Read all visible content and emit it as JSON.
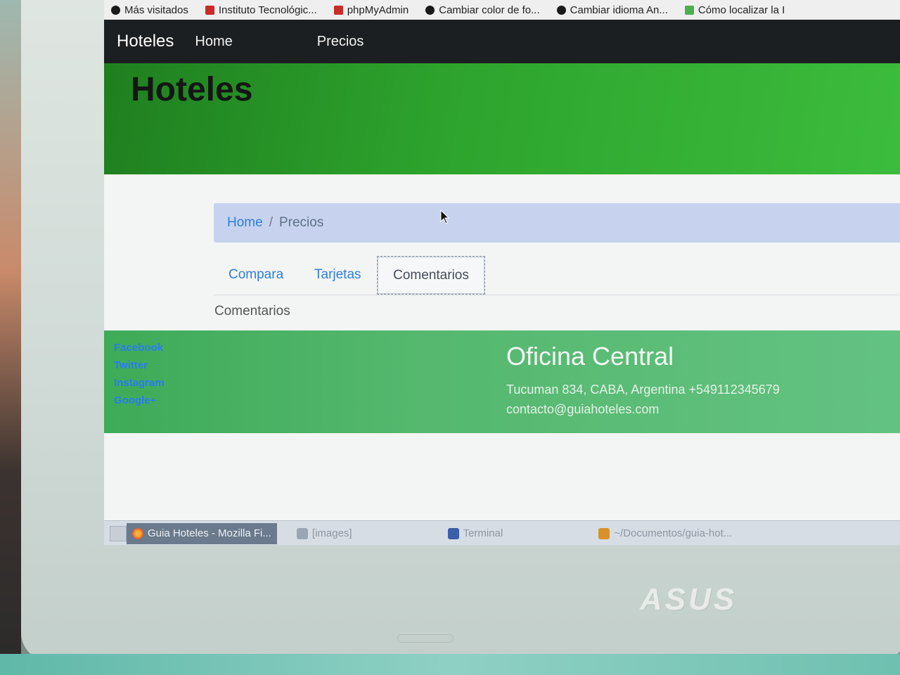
{
  "bookmarks": [
    {
      "label": "Más visitados",
      "icon": "globe-icon"
    },
    {
      "label": "Instituto Tecnológic...",
      "icon": "institute-icon"
    },
    {
      "label": "phpMyAdmin",
      "icon": "phpmyadmin-icon"
    },
    {
      "label": "Cambiar color de fo...",
      "icon": "github-icon"
    },
    {
      "label": "Cambiar idioma An...",
      "icon": "github-icon"
    },
    {
      "label": "Cómo localizar la I",
      "icon": "android-icon"
    }
  ],
  "navbar": {
    "brand": "Hoteles",
    "links": [
      {
        "label": "Home"
      },
      {
        "label": "Precios"
      }
    ]
  },
  "jumbotron": {
    "title": "Hoteles"
  },
  "breadcrumb": {
    "home": "Home",
    "separator": "/",
    "current": "Precios"
  },
  "tabs": [
    {
      "label": "Compara",
      "active": false
    },
    {
      "label": "Tarjetas",
      "active": false
    },
    {
      "label": "Comentarios",
      "active": true
    }
  ],
  "tab_content": "Comentarios",
  "footer": {
    "social": [
      "Facebook",
      "Twitter",
      "Instagram",
      "Google+"
    ],
    "office_title": "Oficina Central",
    "address": "Tucuman 834, CABA, Argentina +549112345679",
    "email": "contacto@guiahoteles.com"
  },
  "taskbar": {
    "items": [
      {
        "label": "Guia Hoteles - Mozilla Fi...",
        "icon": "firefox-icon",
        "active": true
      },
      {
        "label": "[images]",
        "icon": "folder-icon",
        "active": false
      },
      {
        "label": "Terminal",
        "icon": "terminal-icon",
        "active": false
      },
      {
        "label": "~/Documentos/guia-hot...",
        "icon": "editor-icon",
        "active": false
      }
    ]
  },
  "device": {
    "brand": "ASUS"
  },
  "colors": {
    "navbar_bg": "#1c1f21",
    "jumbotron_green": "#2ea52e",
    "footer_green": "#55b86e",
    "link_blue": "#2d7fe0",
    "breadcrumb_bg": "#c7d3ee"
  }
}
